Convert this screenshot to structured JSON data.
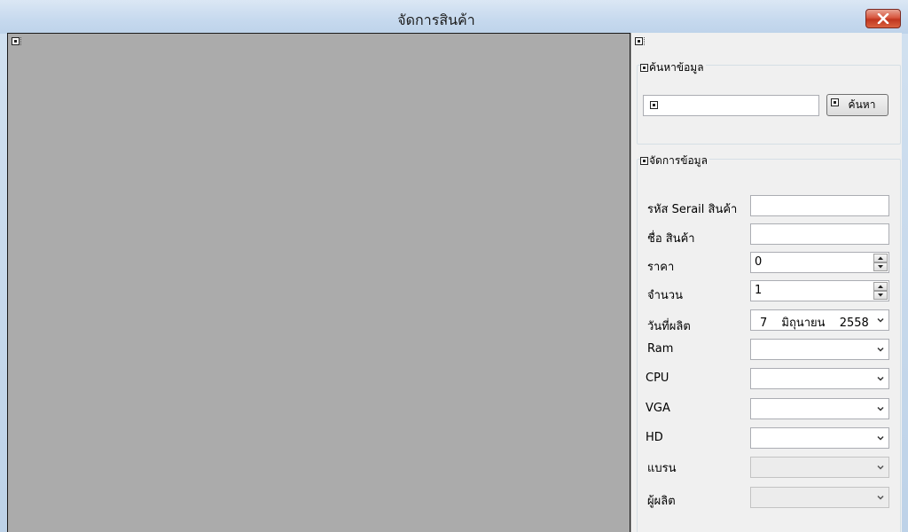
{
  "window": {
    "title": "จัดการสินค้า"
  },
  "search_group": {
    "title": "ค้นหาข้อมูล",
    "input_value": "",
    "button_label": "ค้นหา"
  },
  "data_group": {
    "title": "จัดการข้อมูล",
    "fields": {
      "serial": {
        "label": "รหัส Serail สินค้า",
        "value": ""
      },
      "name": {
        "label": "ชื่อ สินค้า",
        "value": ""
      },
      "price": {
        "label": "ราคา",
        "value": "0"
      },
      "quantity": {
        "label": "จำนวน",
        "value": "1"
      },
      "mfg_date": {
        "label": "วันที่ผลิต",
        "day": "7",
        "month": "มิถุนายน",
        "year": "2558"
      },
      "ram": {
        "label": "Ram",
        "value": ""
      },
      "cpu": {
        "label": "CPU",
        "value": ""
      },
      "vga": {
        "label": "VGA",
        "value": ""
      },
      "hd": {
        "label": "HD",
        "value": ""
      },
      "brand": {
        "label": "แบรน",
        "value": "",
        "enabled": false
      },
      "maker": {
        "label": "ผู้ผลิต",
        "value": "",
        "enabled": false
      }
    }
  },
  "colors": {
    "canvas": "#ababab",
    "panel": "#f0f0f0",
    "close_button": "#c7432b"
  },
  "icons": {
    "close": "close-x-icon",
    "chevron": "chevron-down-icon",
    "spin_up": "spin-up-arrow-icon",
    "spin_down": "spin-down-arrow-icon",
    "placeholder": "designer-control-placeholder-icon"
  }
}
